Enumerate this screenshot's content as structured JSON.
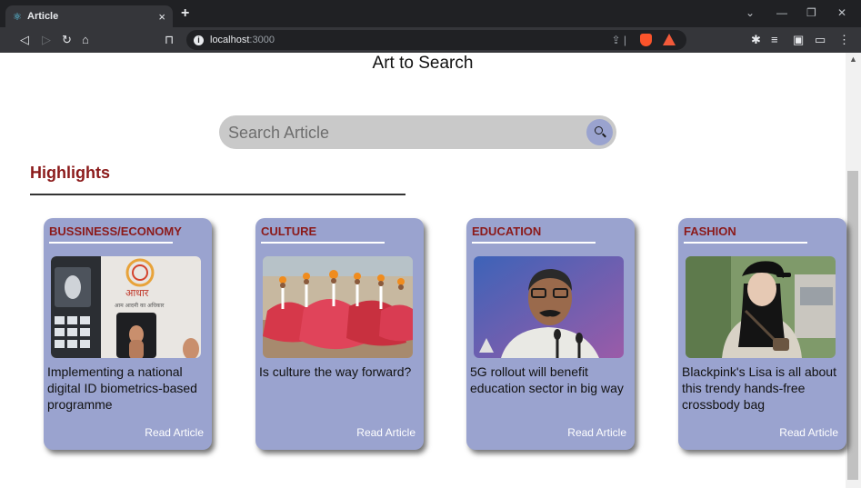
{
  "browser": {
    "tab_title": "Article",
    "tab_close": "×",
    "new_tab": "+",
    "url_host": "localhost",
    "url_port": ":3000"
  },
  "page": {
    "title": "Art to Search",
    "search_placeholder": "Search Article",
    "section_heading": "Highlights"
  },
  "cards": [
    {
      "category": "BUSSINESS/ECONOMY",
      "headline": "Implementing a national digital ID biometrics-based programme",
      "link": "Read Article",
      "image_icon": "fingerprint-scanner-photo",
      "image_text_hindi": "आधार",
      "image_text_sub": "आम आदमी का अधिकार"
    },
    {
      "category": "CULTURE",
      "headline": "Is culture the way forward?",
      "link": "Read Article",
      "image_icon": "folk-dancers-photo"
    },
    {
      "category": "EDUCATION",
      "headline": "5G rollout will benefit education sector in big way",
      "link": "Read Article",
      "image_icon": "speaker-at-microphone-photo"
    },
    {
      "category": "FASHION",
      "headline": "Blackpink's Lisa is all about this trendy hands-free crossbody bag",
      "link": "Read Article",
      "image_icon": "woman-in-cap-photo"
    }
  ],
  "colors": {
    "card_bg": "#9aa3cf",
    "accent": "#8b1a1a",
    "search_bg": "#c9c9c9"
  }
}
